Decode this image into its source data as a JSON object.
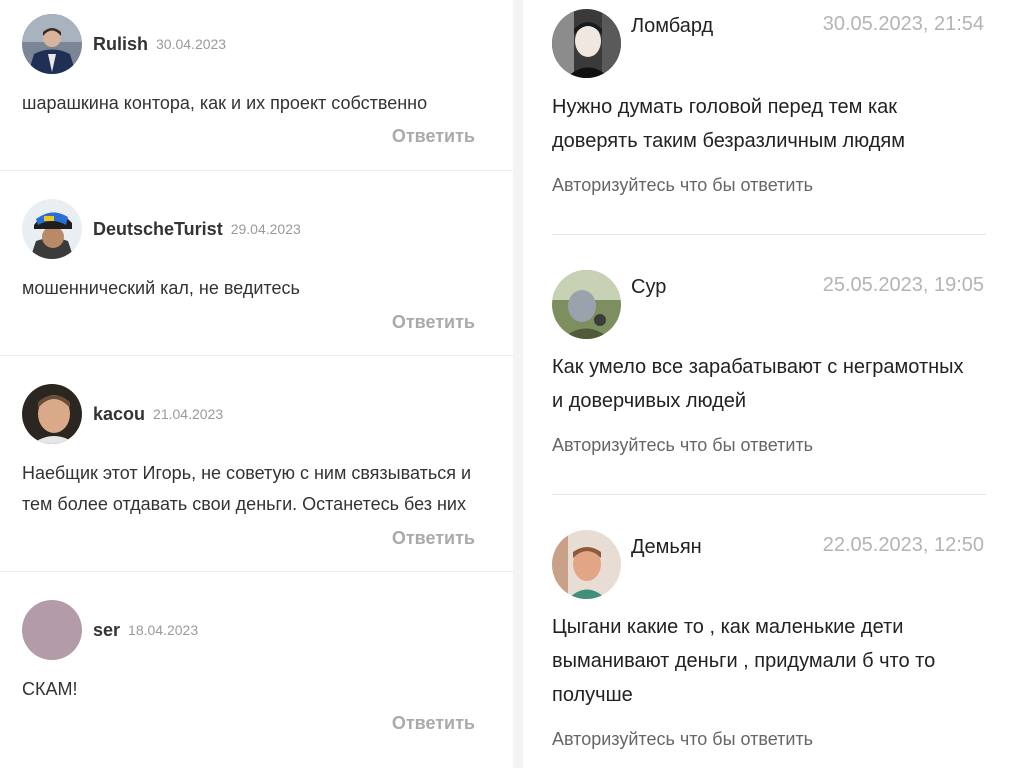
{
  "left_comments": [
    {
      "author": "Rulish",
      "date": "30.04.2023",
      "text_lines": [
        "шарашкина контора, как и их проект собственно"
      ],
      "reply": "Ответить",
      "avatar": "photo-man-suit"
    },
    {
      "author": "DeutscheTurist",
      "date": "29.04.2023",
      "text_lines": [
        "мошеннический кал, не ведитесь"
      ],
      "reply": "Ответить",
      "avatar": "photo-helmet"
    },
    {
      "author": "kacou",
      "date": "21.04.2023",
      "text_lines": [
        "Наебщик этот Игорь, не советую с ним связываться и",
        "тем более отдавать свои деньги. Останетесь без них"
      ],
      "reply": "Ответить",
      "avatar": "photo-man-face"
    },
    {
      "author": "ser",
      "date": "18.04.2023",
      "text_lines": [
        "СКАМ!"
      ],
      "reply": "Ответить",
      "avatar": "plain-mauve",
      "avatar_color": "#b39ba7"
    }
  ],
  "right_comments": [
    {
      "author": "Ломбард",
      "date": "30.05.2023, 21:54",
      "text_lines": [
        "Нужно думать головой перед тем как",
        "доверять таким безразличным людям"
      ],
      "auth": "Авторизуйтесь что бы ответить",
      "avatar": "photo-person-dark"
    },
    {
      "author": "Сур",
      "date": "25.05.2023, 19:05",
      "text_lines": [
        "Как умело все зарабатывают с неграмотных",
        "и доверчивых людей"
      ],
      "auth": "Авторизуйтесь что бы ответить",
      "avatar": "photo-outdoor"
    },
    {
      "author": "Демьян",
      "date": "22.05.2023, 12:50",
      "text_lines": [
        "Цыгани какие то , как маленькие дети",
        "выманивают деньги , придумали б что то",
        "получше"
      ],
      "auth": "Авторизуйтесь что бы ответить",
      "avatar": "photo-child"
    }
  ]
}
